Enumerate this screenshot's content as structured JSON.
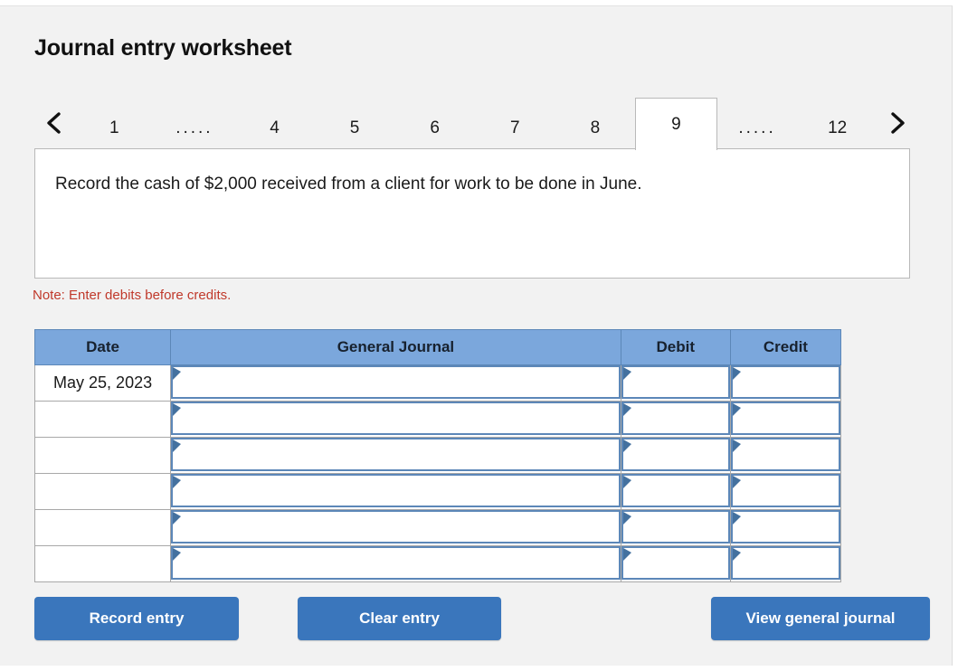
{
  "page": {
    "title": "Journal entry worksheet"
  },
  "pager": {
    "prev_icon": "chevron-left-icon",
    "next_icon": "chevron-right-icon",
    "active_tab": "9",
    "tabs": [
      {
        "label": "1",
        "type": "number",
        "active": false
      },
      {
        "label": ".....",
        "type": "ellipsis",
        "active": false
      },
      {
        "label": "4",
        "type": "number",
        "active": false
      },
      {
        "label": "5",
        "type": "number",
        "active": false
      },
      {
        "label": "6",
        "type": "number",
        "active": false
      },
      {
        "label": "7",
        "type": "number",
        "active": false
      },
      {
        "label": "8",
        "type": "number",
        "active": false
      },
      {
        "label": "9",
        "type": "number",
        "active": true
      },
      {
        "label": ".....",
        "type": "ellipsis",
        "active": false
      },
      {
        "label": "12",
        "type": "number",
        "active": false
      }
    ]
  },
  "scenario": {
    "text": "Record the cash of $2,000 received from a client for work to be done in June."
  },
  "note": {
    "text": "Note: Enter debits before credits.",
    "color": "#c0392b"
  },
  "journal": {
    "headers": {
      "date": "Date",
      "general_journal": "General Journal",
      "debit": "Debit",
      "credit": "Credit"
    },
    "header_bg": "#7ba7dc",
    "rows": [
      {
        "date": "May 25, 2023",
        "account": "",
        "debit": "",
        "credit": ""
      },
      {
        "date": "",
        "account": "",
        "debit": "",
        "credit": ""
      },
      {
        "date": "",
        "account": "",
        "debit": "",
        "credit": ""
      },
      {
        "date": "",
        "account": "",
        "debit": "",
        "credit": ""
      },
      {
        "date": "",
        "account": "",
        "debit": "",
        "credit": ""
      },
      {
        "date": "",
        "account": "",
        "debit": "",
        "credit": ""
      }
    ]
  },
  "actions": {
    "record": "Record entry",
    "clear": "Clear entry",
    "view": "View general journal",
    "button_color": "#3a76bc"
  }
}
